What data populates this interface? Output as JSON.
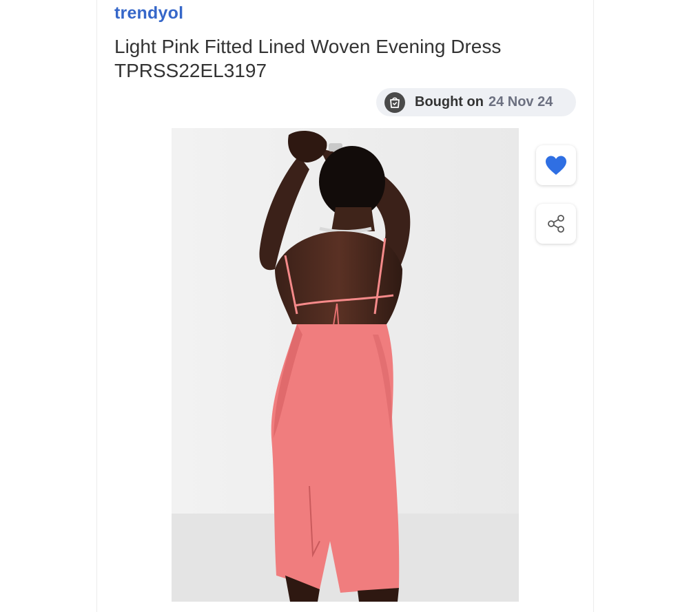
{
  "brand": "trendyol",
  "product": {
    "title": "Light Pink Fitted Lined Woven Evening Dress TPRSS22EL3197"
  },
  "purchase": {
    "label": "Bought on",
    "date": "24 Nov 24"
  },
  "icons": {
    "purchase": "shopping-bag-icon",
    "favorite": "heart-icon",
    "share": "share-icon"
  },
  "colors": {
    "brand": "#3667c9",
    "heart": "#2f6fe3",
    "dress": "#f07d7e"
  }
}
